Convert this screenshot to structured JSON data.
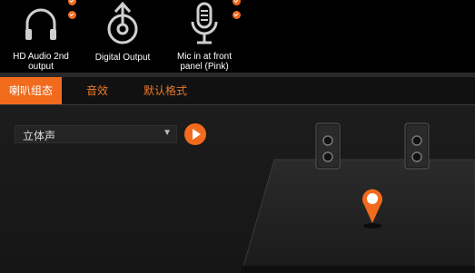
{
  "devices": [
    {
      "name": "HD Audio 2nd output",
      "icon": "headphones-icon",
      "checked": true
    },
    {
      "name": "Digital Output",
      "icon": "digital-output-icon",
      "checked": false
    },
    {
      "name": "Mic in at front panel (Pink)",
      "icon": "microphone-icon",
      "checked": true
    }
  ],
  "device_labels": {
    "hd_line1": "HD Audio 2nd",
    "hd_line2": "output",
    "digital": "Digital Output",
    "mic_line1": "Mic in at front",
    "mic_line2": "panel (Pink)"
  },
  "tabs": [
    {
      "label": "喇叭组态",
      "active": true
    },
    {
      "label": "音效",
      "active": false
    },
    {
      "label": "默认格式",
      "active": false
    }
  ],
  "speaker_config": {
    "selected": "立体声"
  },
  "colors": {
    "accent": "#f26b1d",
    "background": "#000000",
    "panel": "#1a1a1a"
  }
}
